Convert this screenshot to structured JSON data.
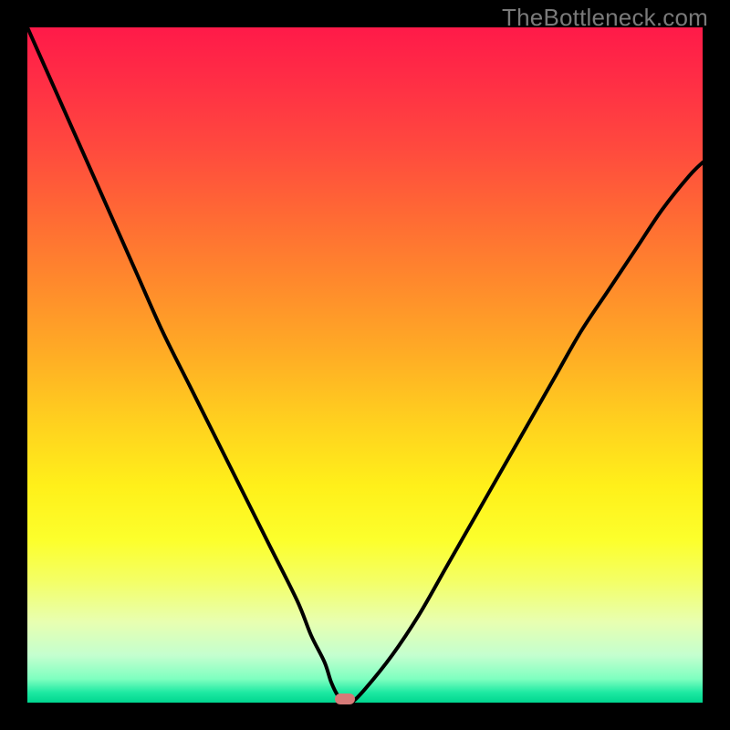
{
  "watermark": "TheBottleneck.com",
  "colors": {
    "frame": "#000000",
    "curve": "#000000",
    "marker": "#d67a78",
    "gradient_top": "#ff1a49",
    "gradient_bottom": "#00d68f"
  },
  "chart_data": {
    "type": "line",
    "title": "",
    "xlabel": "",
    "ylabel": "",
    "xlim": [
      0,
      100
    ],
    "ylim": [
      0,
      100
    ],
    "grid": false,
    "legend": false,
    "series": [
      {
        "name": "bottleneck-curve",
        "x": [
          0,
          4,
          8,
          12,
          16,
          20,
          24,
          28,
          32,
          36,
          40,
          42,
          44,
          45,
          46,
          47,
          48,
          50,
          54,
          58,
          62,
          66,
          70,
          74,
          78,
          82,
          86,
          90,
          94,
          98,
          100
        ],
        "values": [
          100,
          91,
          82,
          73,
          64,
          55,
          47,
          39,
          31,
          23,
          15,
          10,
          6,
          3,
          1,
          0,
          0,
          2,
          7,
          13,
          20,
          27,
          34,
          41,
          48,
          55,
          61,
          67,
          73,
          78,
          80
        ]
      }
    ],
    "marker": {
      "x": 47,
      "y": 0,
      "shape": "rounded-rect"
    }
  }
}
